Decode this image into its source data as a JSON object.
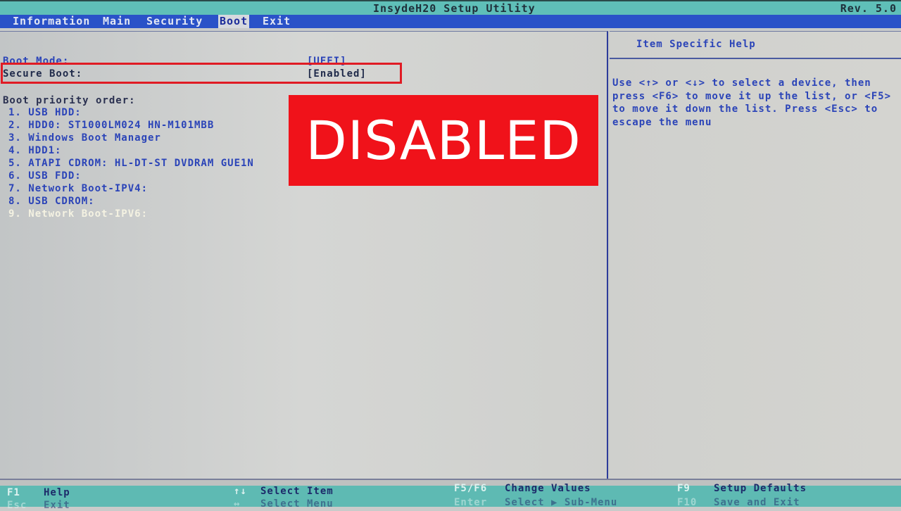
{
  "title_bar": {
    "title": "InsydeH20 Setup Utility",
    "revision": "Rev. 5.0"
  },
  "menu": {
    "tabs": [
      {
        "label": "Information",
        "active": false
      },
      {
        "label": "Main",
        "active": false
      },
      {
        "label": "Security",
        "active": false
      },
      {
        "label": "Boot",
        "active": true
      },
      {
        "label": "Exit",
        "active": false
      }
    ]
  },
  "main": {
    "boot_mode": {
      "label": "Boot Mode:",
      "value": "[UEFI]"
    },
    "secure_boot": {
      "label": "Secure Boot:",
      "value": "[Enabled]"
    },
    "priority_title": "Boot priority order:",
    "priority_items": [
      "1. USB HDD:",
      "2. HDD0: ST1000LM024 HN-M101MBB",
      "3. Windows Boot Manager",
      "4. HDD1:",
      "5. ATAPI CDROM: HL-DT-ST DVDRAM GUE1N",
      "6. USB FDD:",
      "7. Network Boot-IPV4:",
      "8. USB CDROM:",
      "9. Network Boot-IPV6:"
    ],
    "selected_index": 8
  },
  "overlay": {
    "banner_text": "DISABLED",
    "banner_color": "#f0121a",
    "highlight_color": "#e01b24"
  },
  "help": {
    "title": "Item Specific Help",
    "body": "Use <↑> or <↓> to select a device, then press <F6> to move it up the list, or <F5> to move it down the list. Press <Esc> to escape the menu"
  },
  "footer": {
    "row1": [
      {
        "key": "F1",
        "desc": "Help"
      },
      {
        "key": "↑↓",
        "desc": "Select Item"
      },
      {
        "key": "F5/F6",
        "desc": "Change Values"
      },
      {
        "key": "F9",
        "desc": "Setup Defaults"
      }
    ],
    "row2": [
      {
        "key": "Esc",
        "desc": "Exit"
      },
      {
        "key": "↔",
        "desc": "Select Menu"
      },
      {
        "key": "Enter",
        "desc": "Select ▶ Sub-Menu"
      },
      {
        "key": "F10",
        "desc": "Save and Exit"
      }
    ]
  },
  "colors": {
    "menu_bar": "#2a52c8",
    "title_bar": "#5fbfb8",
    "text_blue": "#2b44b8",
    "footer": "#5ebab3"
  }
}
